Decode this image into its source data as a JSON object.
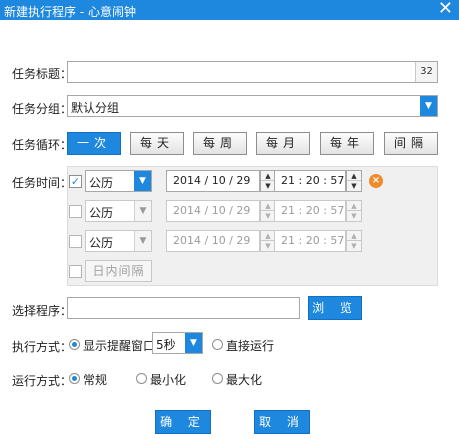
{
  "window": {
    "title": "新建执行程序 - 心意闹钟",
    "close_glyph": "✕"
  },
  "task_title": {
    "label": "任务标题：",
    "value": "",
    "counter": "32"
  },
  "task_group": {
    "label": "任务分组：",
    "value": "默认分组"
  },
  "task_cycle": {
    "label": "任务循环：",
    "options": [
      "一次",
      "每天",
      "每周",
      "每月",
      "每年",
      "间隔"
    ],
    "selected": "一次"
  },
  "task_time": {
    "label": "任务时间：",
    "rows": [
      {
        "checked": true,
        "enabled": true,
        "calendar": "公历",
        "date": "2014 / 10 / 29",
        "time": "21 : 20 : 57"
      },
      {
        "checked": false,
        "enabled": false,
        "calendar": "公历",
        "date": "2014 / 10 / 29",
        "time": "21 : 20 : 57"
      },
      {
        "checked": false,
        "enabled": false,
        "calendar": "公历",
        "date": "2014 / 10 / 29",
        "time": "21 : 20 : 57"
      }
    ],
    "intraday_label": "日内间隔"
  },
  "program": {
    "label": "选择程序：",
    "value": "",
    "browse_label": "浏 览"
  },
  "exec_mode": {
    "label": "执行方式：",
    "option_reminder": "显示提醒窗口",
    "reminder_seconds": "5秒",
    "option_direct": "直接运行",
    "selected": "reminder"
  },
  "run_mode": {
    "label": "运行方式：",
    "options": [
      "常规",
      "最小化",
      "最大化"
    ],
    "selected": "常规"
  },
  "footer": {
    "ok_label": "确 定",
    "cancel_label": "取 消"
  },
  "colors": {
    "accent": "#1e87de",
    "delete": "#f08a2a"
  }
}
